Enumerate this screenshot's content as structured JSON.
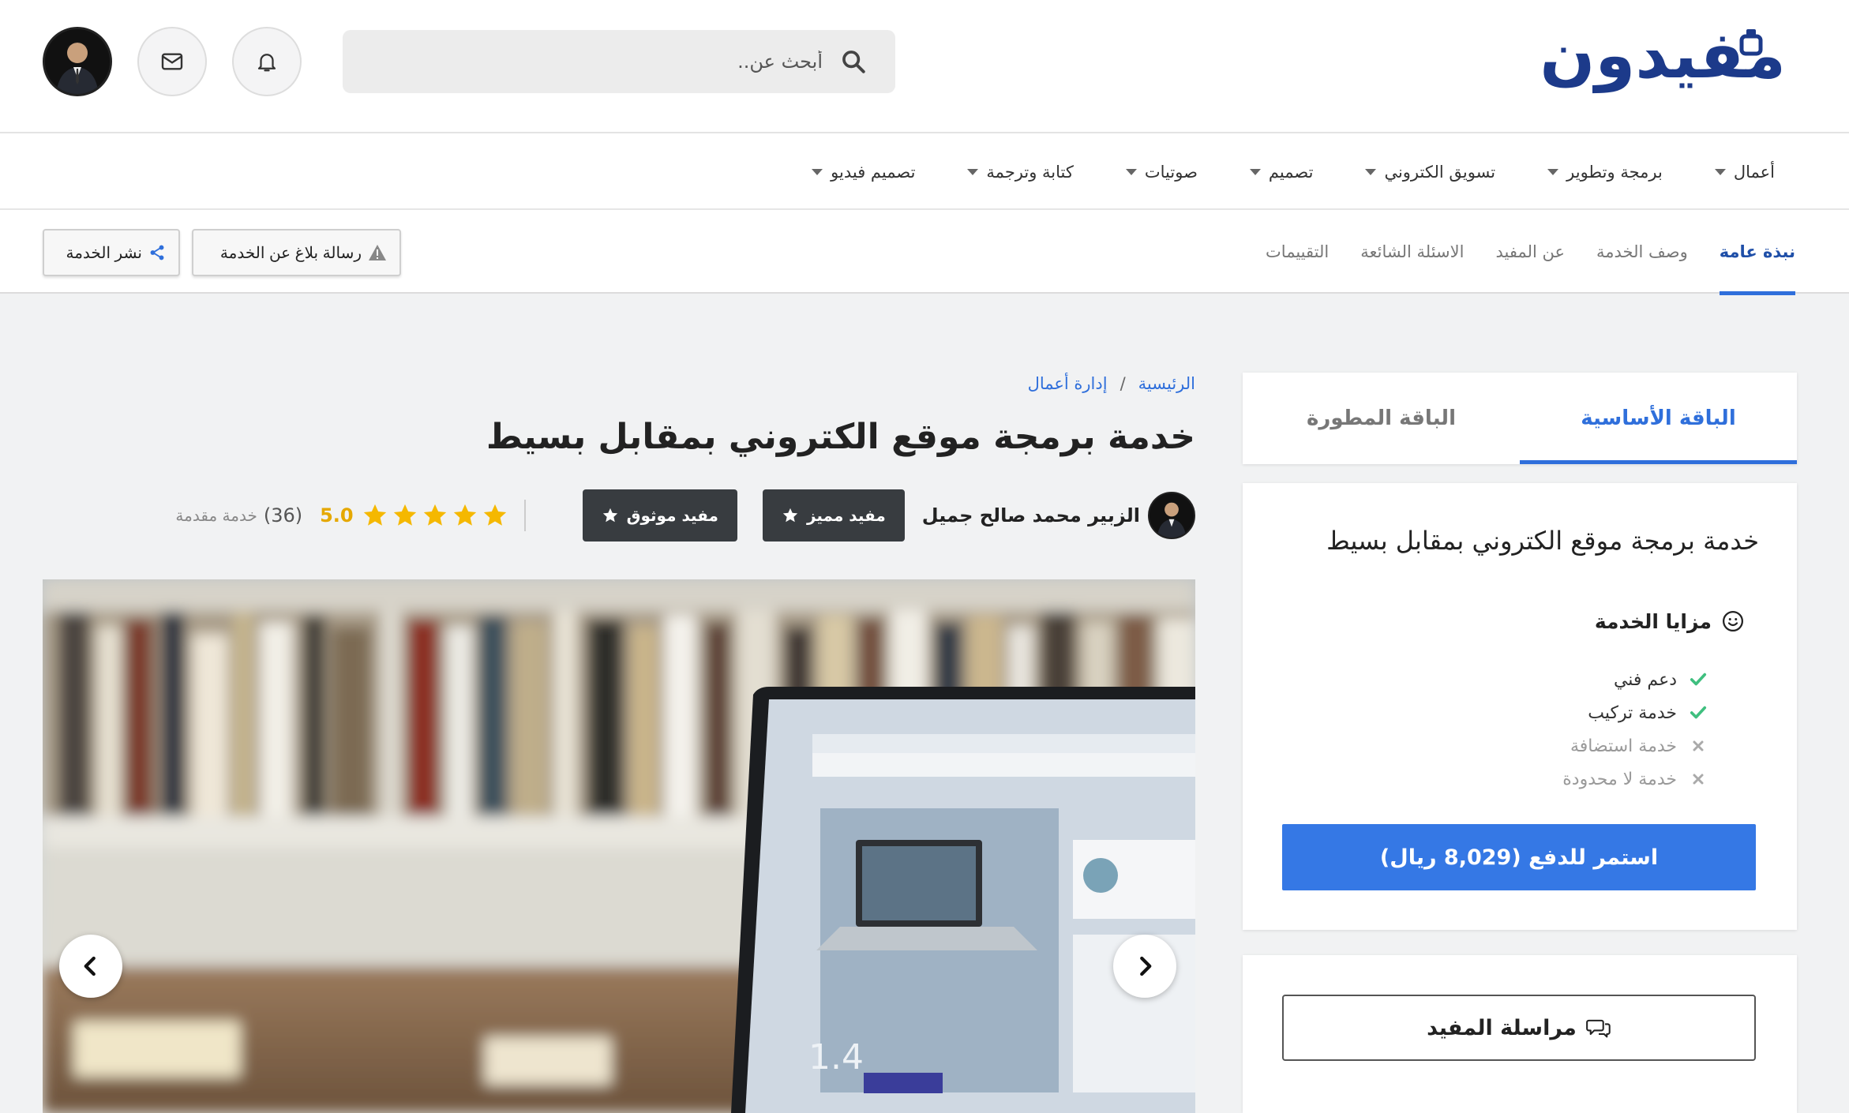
{
  "brand": {
    "logo_text": "مفيدون",
    "accent": "#2f6fdb",
    "logo_color": "#1c3a8a"
  },
  "header": {
    "search_placeholder": "أبحث عن..",
    "icons": [
      "search-icon",
      "bell-icon",
      "mail-icon"
    ]
  },
  "categories": [
    {
      "label": "أعمال"
    },
    {
      "label": "برمجة وتطوير"
    },
    {
      "label": "تسويق الكتروني"
    },
    {
      "label": "تصميم"
    },
    {
      "label": "صوتيات"
    },
    {
      "label": "كتابة وترجمة"
    },
    {
      "label": "تصميم فيديو"
    }
  ],
  "section_tabs": [
    {
      "label": "نبذة عامة",
      "active": true
    },
    {
      "label": "وصف الخدمة"
    },
    {
      "label": "عن المفيد"
    },
    {
      "label": "الاسئلة الشائعة"
    },
    {
      "label": "التقييمات"
    }
  ],
  "actions": {
    "report": "رسالة بلاغ عن الخدمة",
    "share": "نشر الخدمة"
  },
  "breadcrumb": {
    "home": "الرئيسية",
    "separator": "/",
    "category": "إدارة أعمال"
  },
  "service": {
    "title": "خدمة برمجة موقع الكتروني بمقابل بسيط",
    "seller_name": "الزبير محمد صالح جميل",
    "badges": [
      "مفيد مميز",
      "مفيد موثوق"
    ],
    "rating": {
      "value": "5.0",
      "stars": 5,
      "count": "(36)",
      "label": "خدمة مقدمة"
    }
  },
  "packages": {
    "tabs": [
      {
        "label": "الباقة الأساسية",
        "active": true
      },
      {
        "label": "الباقة المطورة"
      }
    ],
    "title": "خدمة برمجة موقع الكتروني بمقابل بسيط",
    "features_title": "مزايا الخدمة",
    "features": [
      {
        "label": "دعم فني",
        "included": true
      },
      {
        "label": "خدمة تركيب",
        "included": true
      },
      {
        "label": "خدمة استضافة",
        "included": false
      },
      {
        "label": "خدمة لا محدودة",
        "included": false
      }
    ],
    "pay_button": "استمر للدفع (8,029 ريال)",
    "message_button": "مراسلة المفيد"
  }
}
